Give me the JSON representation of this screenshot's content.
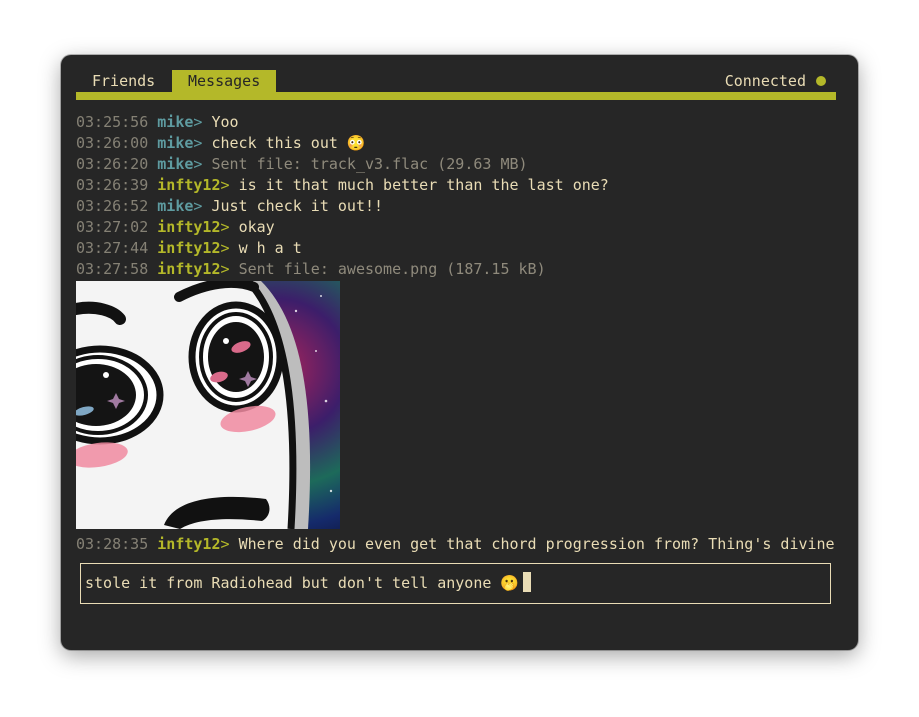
{
  "tabs": [
    {
      "label": "Friends",
      "active": false
    },
    {
      "label": "Messages",
      "active": true
    }
  ],
  "status": {
    "label": "Connected",
    "indicator_color": "#b4b829"
  },
  "colors": {
    "background": "#262626",
    "accent": "#b4b829",
    "text": "#e9dcb5",
    "timestamp": "#858175",
    "mike": "#5e9ba0"
  },
  "messages": [
    {
      "time": "03:25:56",
      "nick": "mike",
      "sep": ">",
      "text": "Yoo"
    },
    {
      "time": "03:26:00",
      "nick": "mike",
      "sep": ">",
      "text": "check this out 😳"
    },
    {
      "time": "03:26:20",
      "nick": "mike",
      "sep": ">",
      "text": "Sent file: track_v3.flac (29.63 MB)"
    },
    {
      "time": "03:26:39",
      "nick": "infty12",
      "sep": ">",
      "text": "is it that much better than the last one?"
    },
    {
      "time": "03:26:52",
      "nick": "mike",
      "sep": ">",
      "text": "Just check it out!!"
    },
    {
      "time": "03:27:02",
      "nick": "infty12",
      "sep": ">",
      "text": "okay"
    },
    {
      "time": "03:27:44",
      "nick": "infty12",
      "sep": ">",
      "text": "w h a t"
    },
    {
      "time": "03:27:58",
      "nick": "infty12",
      "sep": ">",
      "text": "Sent file: awesome.png (187.15 kB)"
    },
    {
      "time": "03:28:35",
      "nick": "infty12",
      "sep": ">",
      "text": "Where did you even get that chord progression from? Thing's divine"
    }
  ],
  "attachment_image": {
    "filename": "awesome.png"
  },
  "input": {
    "value": "stole it from Radiohead but don't tell anyone 🫢"
  }
}
